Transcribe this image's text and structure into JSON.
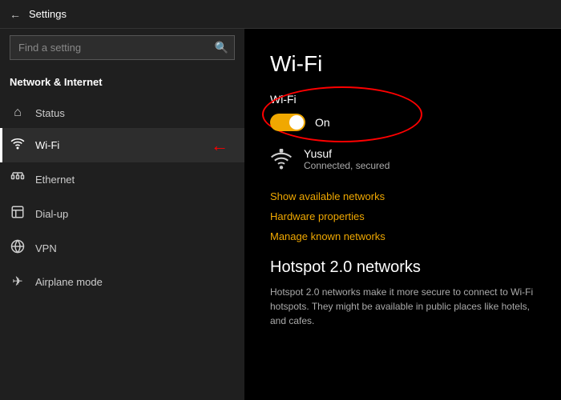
{
  "titleBar": {
    "title": "Settings",
    "backLabel": "←"
  },
  "sidebar": {
    "searchPlaceholder": "Find a setting",
    "searchIcon": "🔍",
    "sectionTitle": "Network & Internet",
    "navItems": [
      {
        "id": "status",
        "label": "Status",
        "icon": "⌂",
        "active": false
      },
      {
        "id": "wifi",
        "label": "Wi-Fi",
        "icon": "📶",
        "active": true
      },
      {
        "id": "ethernet",
        "label": "Ethernet",
        "icon": "🖧",
        "active": false
      },
      {
        "id": "dialup",
        "label": "Dial-up",
        "icon": "📞",
        "active": false
      },
      {
        "id": "vpn",
        "label": "VPN",
        "icon": "🔗",
        "active": false
      },
      {
        "id": "airplane",
        "label": "Airplane mode",
        "icon": "✈",
        "active": false
      }
    ]
  },
  "content": {
    "pageTitle": "Wi-Fi",
    "wifiToggle": {
      "label": "Wi-Fi",
      "toggleState": "On"
    },
    "network": {
      "name": "Yusuf",
      "status": "Connected, secured"
    },
    "links": [
      {
        "id": "show-networks",
        "label": "Show available networks"
      },
      {
        "id": "hardware-props",
        "label": "Hardware properties"
      },
      {
        "id": "manage-networks",
        "label": "Manage known networks"
      }
    ],
    "hotspot": {
      "title": "Hotspot 2.0 networks",
      "description": "Hotspot 2.0 networks make it more secure to connect to Wi-Fi hotspots. They might be available in public places like hotels, and cafes."
    }
  }
}
